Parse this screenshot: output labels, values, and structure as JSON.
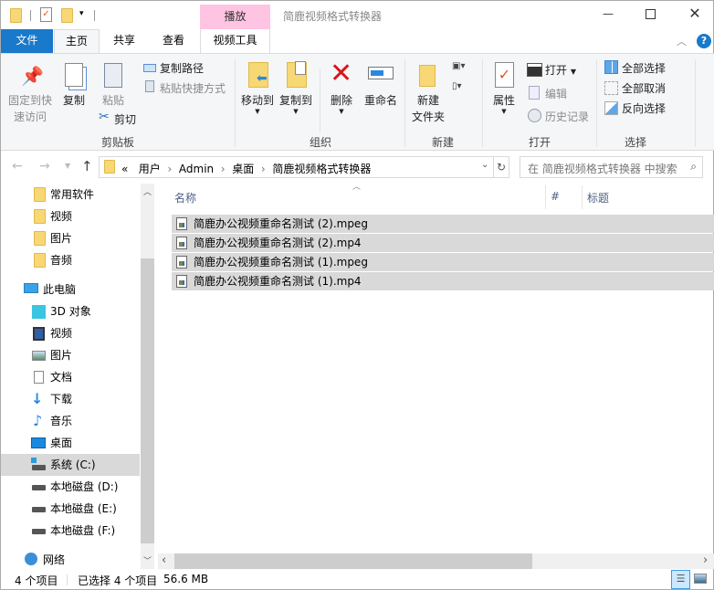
{
  "window": {
    "title": "简鹿视频格式转换器",
    "context_tab": "播放",
    "accent": "#1979ca",
    "context_color": "#ffc4e1"
  },
  "tabs": [
    "文件",
    "主页",
    "共享",
    "查看",
    "视频工具"
  ],
  "ribbon": {
    "clipboard": {
      "label": "剪贴板",
      "pin": "固定到快\n速访问",
      "pin1": "固定到快",
      "pin2": "速访问",
      "copy": "复制",
      "paste": "粘贴",
      "copy_path": "复制路径",
      "paste_shortcut": "粘贴快捷方式",
      "cut": "剪切"
    },
    "organize": {
      "label": "组织",
      "move_to": "移动到",
      "copy_to": "复制到",
      "delete": "删除",
      "rename": "重命名"
    },
    "new": {
      "label": "新建",
      "new_folder1": "新建",
      "new_folder2": "文件夹"
    },
    "open": {
      "label": "打开",
      "properties": "属性",
      "open": "打开",
      "edit": "编辑",
      "history": "历史记录"
    },
    "select": {
      "label": "选择",
      "select_all": "全部选择",
      "select_none": "全部取消",
      "invert": "反向选择"
    }
  },
  "address": {
    "prefix": "«",
    "crumbs": [
      "用户",
      "Admin",
      "桌面",
      "简鹿视频格式转换器"
    ],
    "search_placeholder": "在 简鹿视频格式转换器 中搜索"
  },
  "nav": {
    "quick": [
      "常用软件",
      "视频",
      "图片",
      "音频"
    ],
    "this_pc": "此电脑",
    "pc_items": [
      "3D 对象",
      "视频",
      "图片",
      "文档",
      "下载",
      "音乐",
      "桌面",
      "系统 (C:)",
      "本地磁盘 (D:)",
      "本地磁盘 (E:)",
      "本地磁盘 (F:)"
    ],
    "network": "网络"
  },
  "columns": [
    "名称",
    "#",
    "标题"
  ],
  "files": [
    "简鹿办公视频重命名测试 (2).mpeg",
    "简鹿办公视频重命名测试 (2).mp4",
    "简鹿办公视频重命名测试 (1).mpeg",
    "简鹿办公视频重命名测试 (1).mp4"
  ],
  "status": {
    "count": "4 个项目",
    "selected": "已选择 4 个项目",
    "size": "56.6 MB"
  }
}
